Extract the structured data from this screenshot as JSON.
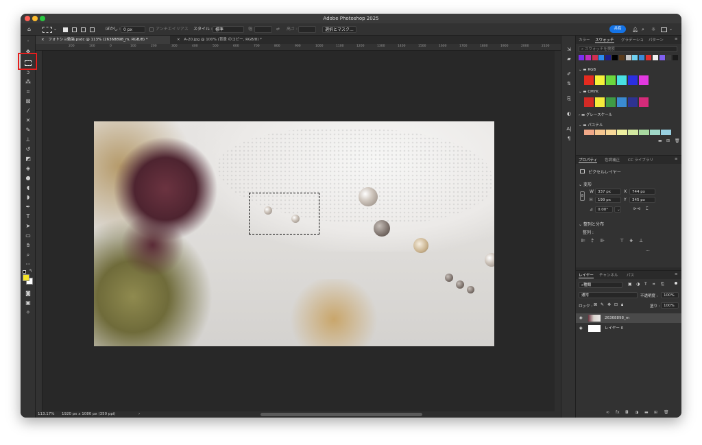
{
  "window": {
    "title": "Adobe Photoshop 2025"
  },
  "options_bar": {
    "feather_label": "ぼかし :",
    "feather_value": "0 px",
    "antialias_label": "アンチエイリアス",
    "style_label": "スタイル :",
    "style_value": "標準",
    "width_label": "幅",
    "height_label": "高さ :",
    "select_mask_button": "選択とマスク...",
    "share_button": "共有"
  },
  "tabs": [
    {
      "label": "フォトショ勉強.psdc @ 113% (26368898_m, RGB/8) *",
      "active": true
    },
    {
      "label": "A-20.jpg @ 100% (背景 のコピー, RGB/8) *",
      "active": false
    }
  ],
  "ruler": {
    "ticks": [
      "200",
      "100",
      "0",
      "100",
      "200",
      "300",
      "400",
      "500",
      "600",
      "700",
      "800",
      "900",
      "1000",
      "1100",
      "1200",
      "1300",
      "1400",
      "1500",
      "1600",
      "1700",
      "1800",
      "1900",
      "2000",
      "2100"
    ]
  },
  "status": {
    "zoom": "113.17%",
    "doc_info": "1920 px x 1080 px (350 ppi)"
  },
  "swatches_panel": {
    "tabs": [
      "カラー",
      "スウォッチ",
      "グラデーショ",
      "パターン"
    ],
    "active_tab": "スウォッチ",
    "search_placeholder": "スウォッチを検索",
    "recent_colors": [
      "#7b2ff0",
      "#c02ec0",
      "#d03050",
      "#2d8cf0",
      "#1e1e8a",
      "#000000",
      "#5a3b1b",
      "#c8c8c8",
      "#6fd0f0",
      "#3a8ad8",
      "#e03030",
      "#f0f0f0",
      "#8060f0",
      "#3d3d3d",
      "#1a1a1a"
    ],
    "groups": [
      {
        "name": "RGB",
        "colors": [
          "#e52b1f",
          "#f6f13a",
          "#6cd83e",
          "#49e0e3",
          "#2b2fe0",
          "#e239e0"
        ]
      },
      {
        "name": "CMYK",
        "colors": [
          "#d32a25",
          "#f4eb3c",
          "#3f9b45",
          "#3a8bd1",
          "#2e3391",
          "#d52b7a"
        ]
      },
      {
        "name": "グレースケール",
        "colors": []
      },
      {
        "name": "パステル",
        "colors": [
          "#f0a888",
          "#f6c690",
          "#f8d898",
          "#eef0a0",
          "#d2e8a0",
          "#a8d8a0",
          "#a0d8c8",
          "#98d0e0"
        ]
      }
    ]
  },
  "properties_panel": {
    "tabs": [
      "プロパティ",
      "色調補正",
      "CC ライブラリ"
    ],
    "active_tab": "プロパティ",
    "layer_type": "ピクセルレイヤー",
    "transform_title": "変形",
    "w_label": "W",
    "w_value": "337 px",
    "h_label": "H",
    "h_value": "199 px",
    "x_label": "X",
    "x_value": "744 px",
    "y_label": "Y",
    "y_value": "345 px",
    "angle_value": "0.00°",
    "align_title": "整列と分布",
    "align_sub": "整列 :",
    "more": "..."
  },
  "layers_panel": {
    "tabs": [
      "レイヤー",
      "チャンネル",
      "パス"
    ],
    "active_tab": "レイヤー",
    "filter_label": "種類",
    "blend_mode": "通常",
    "opacity_label": "不透明度 :",
    "opacity_value": "100%",
    "lock_label": "ロック :",
    "fill_label": "塗り :",
    "fill_value": "100%",
    "layers": [
      {
        "name": "26368898_m",
        "selected": true
      },
      {
        "name": "レイヤー 0",
        "selected": false
      }
    ]
  },
  "colors": {
    "accent": "#1473e6",
    "highlight": "#e4201f",
    "foreground": "#f6e52a",
    "background": "#ffffff"
  }
}
